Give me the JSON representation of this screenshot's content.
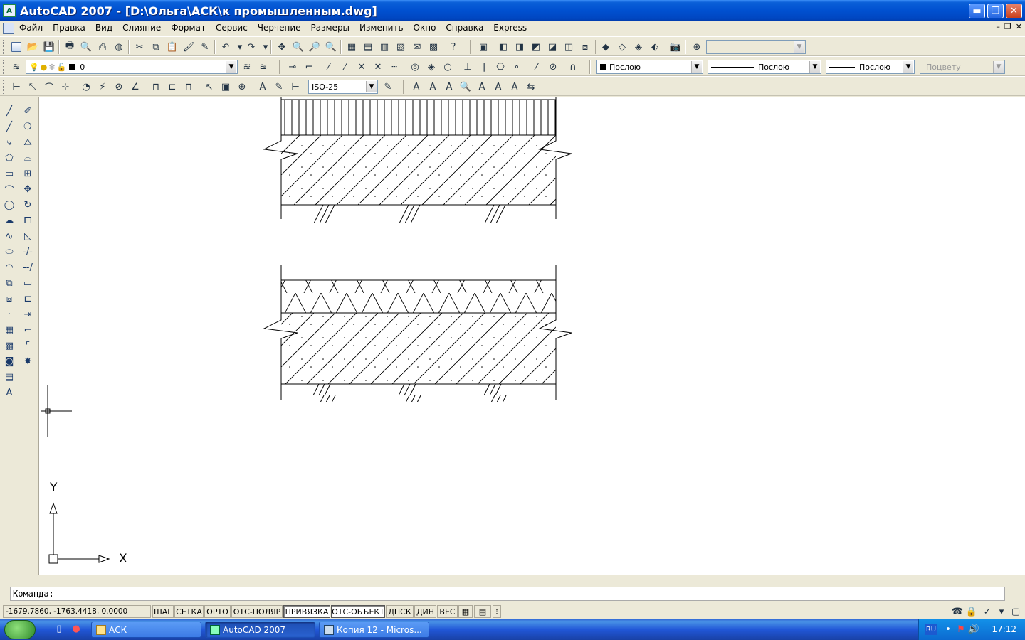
{
  "window": {
    "title": "AutoCAD 2007 - [D:\\Ольга\\АСК\\к промышленным.dwg]",
    "minimize": "▬",
    "restore": "❐",
    "close": "✕"
  },
  "menu": {
    "items": [
      "Файл",
      "Правка",
      "Вид",
      "Слияние",
      "Формат",
      "Сервис",
      "Черчение",
      "Размеры",
      "Изменить",
      "Окно",
      "Справка",
      "Express"
    ],
    "right_controls": [
      "–",
      "❐",
      "✕"
    ]
  },
  "layers_toolbar": {
    "layer_value": "0"
  },
  "properties_toolbar": {
    "color_value": "Послою",
    "linetype_value": "Послою",
    "lineweight_value": "Послою",
    "plotstyle_value": "Поцвету"
  },
  "dimension_toolbar": {
    "dimstyle_value": "ISO-25"
  },
  "canvas": {
    "ucs_y": "Y",
    "ucs_x": "X"
  },
  "command": {
    "prompt": "Команда:"
  },
  "status": {
    "coordinates": "-1679.7860, -1763.4418, 0.0000",
    "buttons": [
      {
        "label": "ШАГ",
        "on": false
      },
      {
        "label": "СЕТКА",
        "on": false
      },
      {
        "label": "ОРТО",
        "on": false
      },
      {
        "label": "ОТС-ПОЛЯР",
        "on": false
      },
      {
        "label": "ПРИВЯЗКА",
        "on": true
      },
      {
        "label": "ОТС-ОБЪЕКТ",
        "on": true
      },
      {
        "label": "ДПСК",
        "on": false
      },
      {
        "label": "ДИН",
        "on": false
      },
      {
        "label": "ВЕС",
        "on": false
      }
    ]
  },
  "taskbar": {
    "tasks": [
      {
        "label": "АСК",
        "active": false
      },
      {
        "label": "AutoCAD 2007",
        "active": true
      },
      {
        "label": "Копия 12 - Micros...",
        "active": false
      }
    ],
    "lang": "RU",
    "clock": "17:12"
  }
}
